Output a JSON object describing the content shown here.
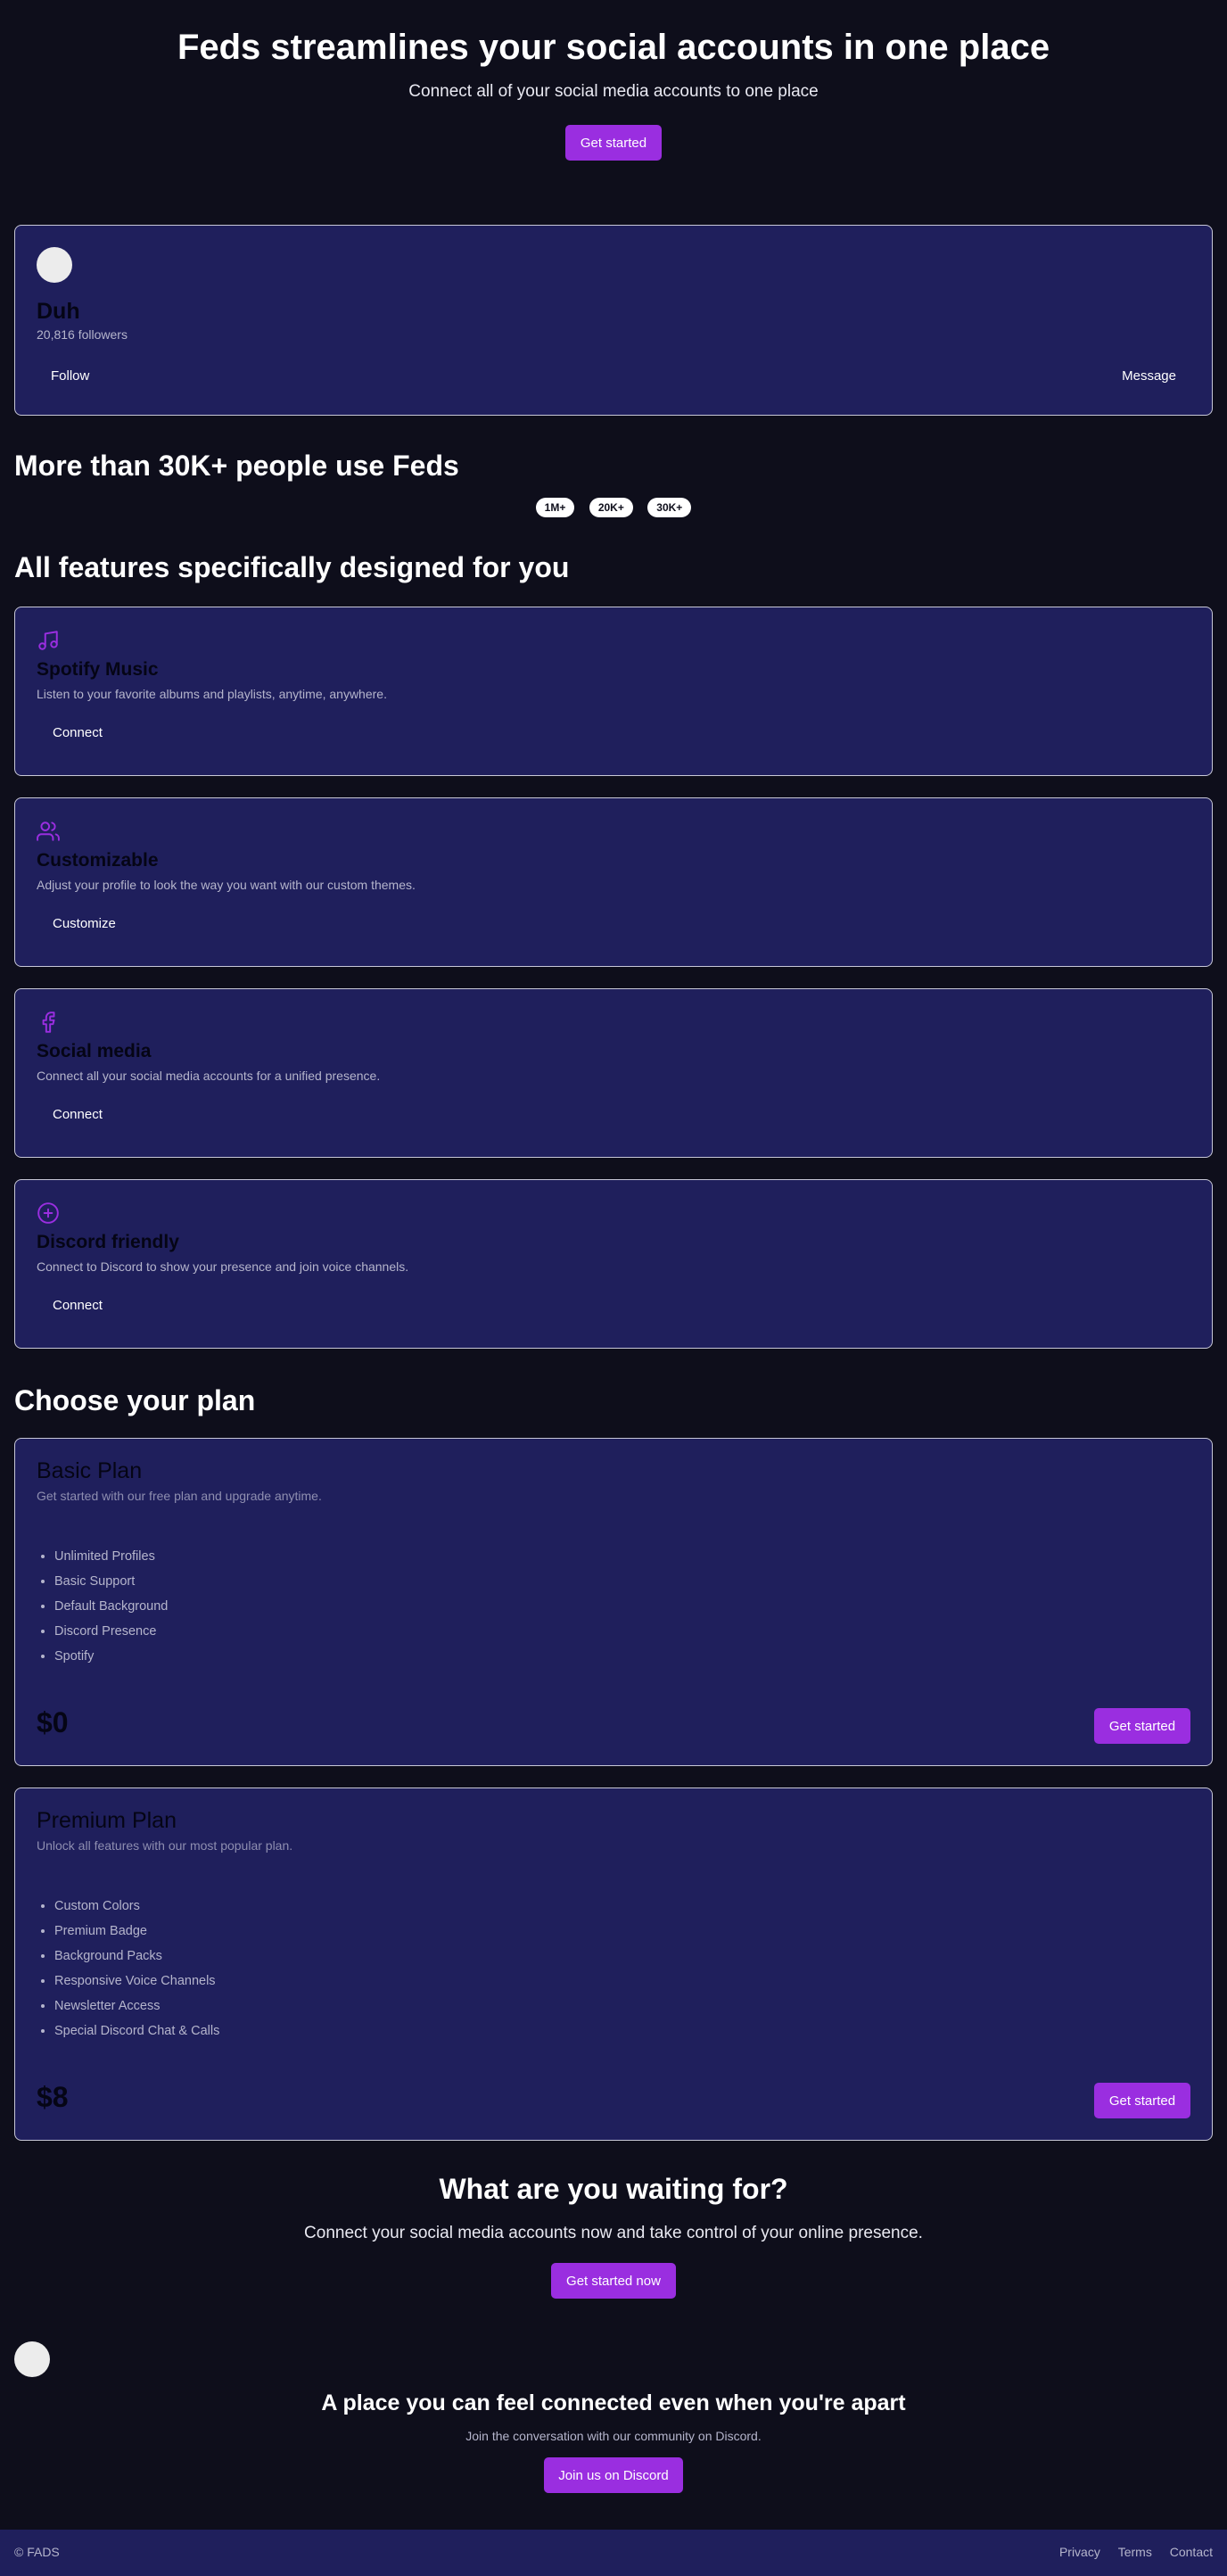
{
  "hero": {
    "title": "Feds streamlines your social accounts in one place",
    "subtitle": "Connect all of your social media accounts to one place",
    "cta_label": "Get started"
  },
  "profile": {
    "name": "Duh",
    "followers": "20,816 followers",
    "follow_label": "Follow",
    "message_label": "Message"
  },
  "social_proof": {
    "title": "More than 30K+ people use Feds",
    "stats": [
      "1M+",
      "20K+",
      "30K+"
    ]
  },
  "features": {
    "title": "All features specifically designed for you",
    "items": [
      {
        "icon": "music-note-icon",
        "title": "Spotify Music",
        "description": "Listen to your favorite albums and playlists, anytime, anywhere.",
        "button": "Connect"
      },
      {
        "icon": "users-icon",
        "title": "Customizable",
        "description": "Adjust your profile to look the way you want with our custom themes.",
        "button": "Customize"
      },
      {
        "icon": "facebook-icon",
        "title": "Social media",
        "description": "Connect all your social media accounts for a unified presence.",
        "button": "Connect"
      },
      {
        "icon": "circle-plus-icon",
        "title": "Discord friendly",
        "description": "Connect to Discord to show your presence and join voice channels.",
        "button": "Connect"
      }
    ]
  },
  "plans": {
    "title": "Choose your plan",
    "items": [
      {
        "name": "Basic Plan",
        "description": "Get started with our free plan and upgrade anytime.",
        "features": [
          "Unlimited Profiles",
          "Basic Support",
          "Default Background",
          "Discord Presence",
          "Spotify"
        ],
        "price": "$0",
        "button": "Get started"
      },
      {
        "name": "Premium Plan",
        "description": "Unlock all features with our most popular plan.",
        "features": [
          "Custom Colors",
          "Premium Badge",
          "Background Packs",
          "Responsive Voice Channels",
          "Newsletter Access",
          "Special Discord Chat & Calls"
        ],
        "price": "$8",
        "button": "Get started"
      }
    ]
  },
  "cta": {
    "title": "What are you waiting for?",
    "subtitle": "Connect your social media accounts now and take control of your online presence.",
    "button": "Get started now"
  },
  "discord": {
    "title": "A place you can feel connected even when you're apart",
    "subtitle": "Join the conversation with our community on Discord.",
    "button": "Join us on Discord"
  },
  "footer": {
    "copyright": "© FADS",
    "links": [
      "Privacy",
      "Terms",
      "Contact"
    ]
  },
  "colors": {
    "background": "#0e0e1b",
    "card": "#1f1f5c",
    "accent": "#9a2ee0"
  }
}
